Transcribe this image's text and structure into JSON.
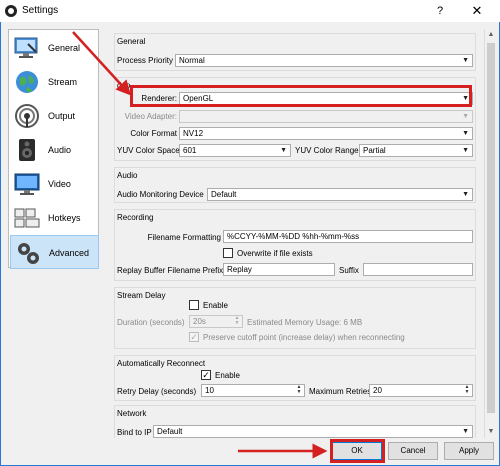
{
  "window": {
    "title": "Settings",
    "help_glyph": "?",
    "close_glyph": "✕"
  },
  "sidebar": {
    "items": [
      {
        "label": "General",
        "icon": "monitor-settings-icon"
      },
      {
        "label": "Stream",
        "icon": "globe-icon"
      },
      {
        "label": "Output",
        "icon": "broadcast-icon"
      },
      {
        "label": "Audio",
        "icon": "speaker-icon"
      },
      {
        "label": "Video",
        "icon": "display-icon"
      },
      {
        "label": "Hotkeys",
        "icon": "keyboard-icon"
      },
      {
        "label": "Advanced",
        "icon": "gears-icon",
        "active": true
      }
    ]
  },
  "general": {
    "title": "General",
    "process_priority_label": "Process Priority",
    "process_priority_value": "Normal"
  },
  "video": {
    "title": "deo",
    "renderer_label": "Renderer:",
    "renderer_value": "OpenGL",
    "video_adapter_label": "Video Adapter:",
    "video_adapter_value": "",
    "color_format_label": "Color Format",
    "color_format_value": "NV12",
    "yuv_color_space_label": "YUV Color Space",
    "yuv_color_space_value": "601",
    "yuv_color_range_label": "YUV Color Range",
    "yuv_color_range_value": "Partial"
  },
  "audio": {
    "title": "Audio",
    "monitoring_device_label": "Audio Monitoring Device",
    "monitoring_device_value": "Default"
  },
  "recording": {
    "title": "Recording",
    "filename_formatting_label": "Filename Formatting",
    "filename_formatting_value": "%CCYY-%MM-%DD %hh-%mm-%ss",
    "overwrite_label": "Overwrite if file exists",
    "replay_prefix_label": "Replay Buffer Filename Prefix",
    "replay_prefix_value": "Replay",
    "suffix_label": "Suffix",
    "suffix_value": ""
  },
  "stream_delay": {
    "title": "Stream Delay",
    "enable_label": "Enable",
    "duration_label": "Duration (seconds)",
    "duration_value": "20s",
    "estimated_memory": "Estimated Memory Usage: 6 MB",
    "preserve_label": "Preserve cutoff point (increase delay) when reconnecting"
  },
  "auto_reconnect": {
    "title": "Automatically Reconnect",
    "enable_label": "Enable",
    "enable_checked_glyph": "✓",
    "retry_delay_label": "Retry Delay (seconds)",
    "retry_delay_value": "10",
    "max_retries_label": "Maximum Retries",
    "max_retries_value": "20"
  },
  "network": {
    "title": "Network",
    "bind_to_ip_label": "Bind to IP",
    "bind_to_ip_value": "Default"
  },
  "footer": {
    "ok_label": "OK",
    "cancel_label": "Cancel",
    "apply_label": "Apply"
  },
  "colors": {
    "annotation": "#d42020",
    "selection": "#cce4f7",
    "accent": "#0078d7"
  }
}
